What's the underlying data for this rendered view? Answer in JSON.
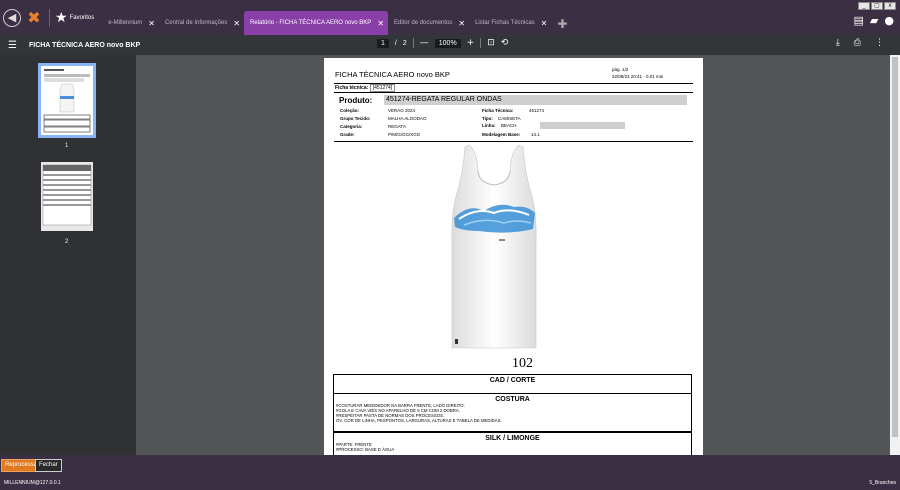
{
  "window": {
    "controls": [
      "_",
      "▢",
      "x"
    ]
  },
  "nav": {
    "back_icon": "back-arrow-icon",
    "logo_icon": "star-logo-icon",
    "favorites_label": "Favoritos"
  },
  "tabs": [
    {
      "label": "e-Millennium",
      "active": false
    },
    {
      "label": "Central de Informações",
      "active": false
    },
    {
      "label": "Relatório - FICHA TÉCNICA AERO novo BKP",
      "active": true
    },
    {
      "label": "Editor de documentos",
      "active": false
    },
    {
      "label": "Listar Fichas Técnicas",
      "active": false
    }
  ],
  "pdf_toolbar": {
    "title": "FICHA TÉCNICA AERO novo BKP",
    "page_current": "1",
    "page_sep": "/",
    "page_total": "2",
    "zoom": "100%",
    "minus": "—",
    "plus": "+"
  },
  "thumbnails": [
    {
      "number": "1"
    },
    {
      "number": "2"
    }
  ],
  "document": {
    "title": "FICHA TÉCNICA AERO novo BKP",
    "page_label": "pág. 1/2",
    "datetime": "22/08/23 20:41 - 0.01 min",
    "ficha_label": "Ficha técnica:",
    "ficha_value": "[451274]",
    "produto_label": "Produto:",
    "produto_value": "451274-REGATA REGULAR ONDAS",
    "fields": {
      "colecao_label": "Coleção:",
      "colecao_value": "VERAO 2024",
      "grupo_label": "Grupo Tecido:",
      "grupo_value": "MALHA ALGODAO",
      "categoria_label": "Categoria:",
      "categoria_value": "REGATA",
      "grade_label": "Grade:",
      "grade_value": "P/M/G/GG/XGG",
      "ficha_tec_label": "Ficha Técnica:",
      "ficha_tec_value": "451274",
      "tipo_label": "Tipo:",
      "tipo_value": "CAMISETA",
      "linha_label": "Linha:",
      "linha_value": "BEACH",
      "modelagem_label": "Modelagem Base:",
      "modelagem_value": "14.1"
    },
    "number": "102",
    "sections": {
      "cad_title": "CAD / CORTE",
      "costura_title": "COSTURA",
      "costura_lines": [
        "#COSTURAR MEDIDEDOR NA BARRA FRENTE, LADO DIREITO.",
        "#GOLA E CAVA VIÉS NO APARELHO DE 5 CM COM 2 DOBRA.",
        "#RESPEITAR PASTA DE NORMAS DOS PROCESSOS.",
        "OV. COR DE LINHA, PESPONTOS, LARGURAS, ALTURAS E TABELA DE MEDIDAS."
      ],
      "silk_title": "SILK / LIMONGE",
      "silk_lines": [
        "#PARTE: FRENTE",
        "#PROCESSO: BASE D ÁGUA"
      ]
    }
  },
  "bottom": {
    "reprocess_label": "Reprocessar",
    "close_label": "Fechar"
  },
  "status": {
    "left": "MILLENNIUM@127.0.0.1",
    "right": "5_Branches"
  }
}
